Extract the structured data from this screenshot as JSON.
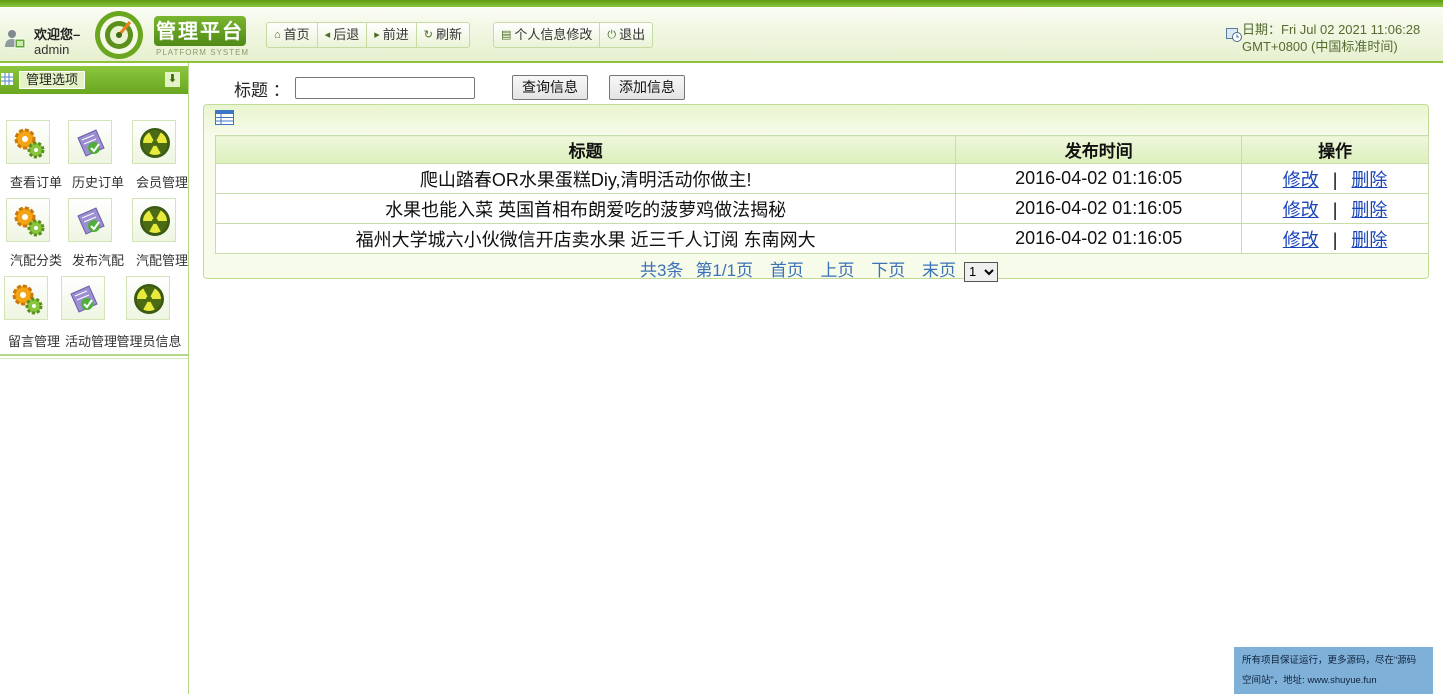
{
  "header": {
    "welcome": "欢迎您–",
    "username": "admin",
    "logo_title": "管理平台",
    "logo_sub": "PLATFORM SYSTEM",
    "nav": [
      {
        "label": "首页",
        "icon": "home-icon"
      },
      {
        "label": "后退",
        "icon": "arrow-left-icon"
      },
      {
        "label": "前进",
        "icon": "arrow-right-icon"
      },
      {
        "label": "刷新",
        "icon": "refresh-icon"
      }
    ],
    "nav2": [
      {
        "label": "个人信息修改",
        "icon": "document-icon"
      },
      {
        "label": "退出",
        "icon": "power-icon"
      }
    ],
    "date_line1": "日期：Fri Jul 02 2021 11:06:28",
    "date_line2": "GMT+0800 (中国标准时间)"
  },
  "sidebar": {
    "title": "管理选项",
    "items": [
      {
        "label": "查看订单",
        "icon": "gears-icon"
      },
      {
        "label": "历史订单",
        "icon": "edit-paper-icon"
      },
      {
        "label": "会员管理",
        "icon": "radiation-icon"
      },
      {
        "label": "汽配分类",
        "icon": "gears-icon"
      },
      {
        "label": "发布汽配",
        "icon": "edit-paper-icon"
      },
      {
        "label": "汽配管理",
        "icon": "radiation-icon"
      },
      {
        "label": "留言管理",
        "icon": "gears-icon"
      },
      {
        "label": "活动管理",
        "icon": "edit-paper-icon"
      },
      {
        "label": "管理员信息",
        "icon": "radiation-icon"
      }
    ]
  },
  "search": {
    "label": "标题 ：",
    "value": "",
    "query_button": "查询信息",
    "add_button": "添加信息"
  },
  "table": {
    "columns": [
      "标题",
      "发布时间",
      "操作"
    ],
    "rows": [
      {
        "title": "爬山踏春OR水果蛋糕Diy,清明活动你做主!",
        "time": "2016-04-02 01:16:05"
      },
      {
        "title": "水果也能入菜 英国首相布朗爱吃的菠萝鸡做法揭秘",
        "time": "2016-04-02 01:16:05"
      },
      {
        "title": "福州大学城六小伙微信开店卖水果 近三千人订阅 东南网大",
        "time": "2016-04-02 01:16:05"
      }
    ],
    "edit_label": "修改",
    "separator": "|",
    "delete_label": "删除"
  },
  "pager": {
    "total": "共3条",
    "page": "第1/1页",
    "first": "首页",
    "prev": "上页",
    "next": "下页",
    "last": "末页",
    "select_value": "1"
  },
  "notice": {
    "line1": "所有项目保证运行，更多源码，尽在“源码",
    "line2": "空间站”，地址: www.shuyue.fun"
  },
  "colors": {
    "accent_green": "#8cc63f",
    "link_blue": "#1a44b8",
    "pager_blue": "#3b72b8",
    "notice_bg": "#7fb0d8"
  }
}
